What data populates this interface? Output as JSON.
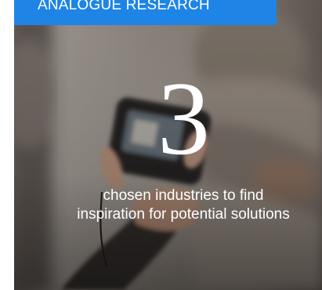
{
  "tag": {
    "label": "ANALOGUE RESEARCH"
  },
  "stat": {
    "number": "3",
    "caption": "chosen industries to find inspiration for potential solutions"
  },
  "colors": {
    "tag_background": "#1e84e6",
    "text": "#ffffff"
  }
}
